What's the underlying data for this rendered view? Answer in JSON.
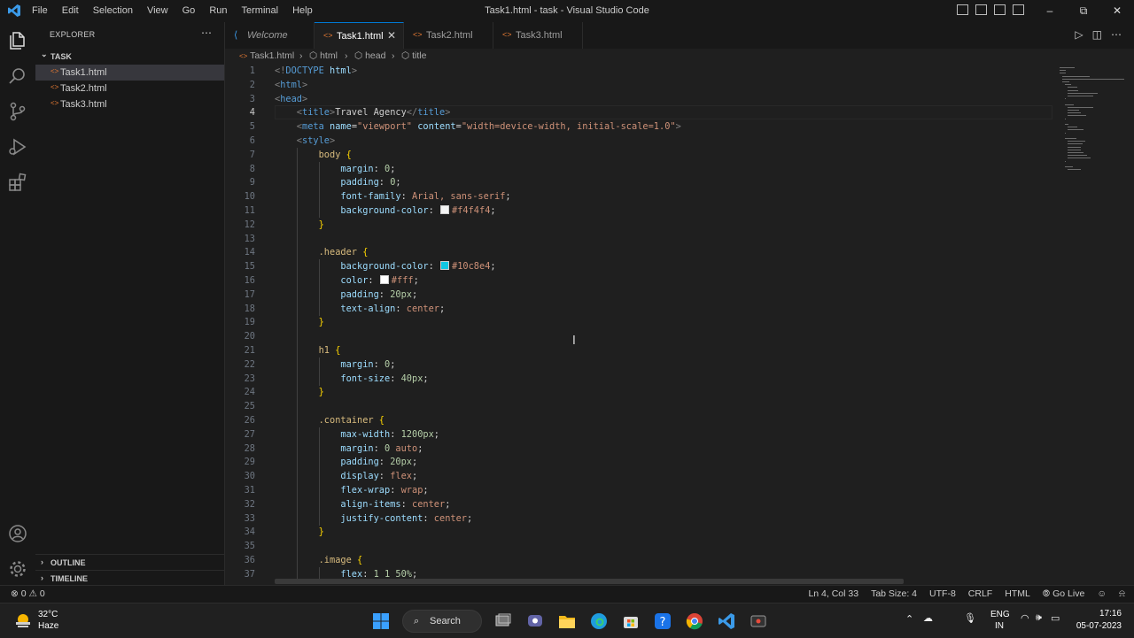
{
  "window": {
    "title": "Task1.html - task - Visual Studio Code",
    "menu": [
      "File",
      "Edit",
      "Selection",
      "View",
      "Go",
      "Run",
      "Terminal",
      "Help"
    ]
  },
  "sidebar": {
    "header": "EXPLORER",
    "folder": "TASK",
    "files": [
      "Task1.html",
      "Task2.html",
      "Task3.html"
    ],
    "outline": "OUTLINE",
    "timeline": "TIMELINE"
  },
  "tabs": [
    {
      "label": "Welcome"
    },
    {
      "label": "Task1.html"
    },
    {
      "label": "Task2.html"
    },
    {
      "label": "Task3.html"
    }
  ],
  "breadcrumb": [
    "Task1.html",
    "html",
    "head",
    "title"
  ],
  "editor": {
    "lines": [
      {
        "n": "1",
        "indent": 0,
        "parts": [
          [
            "<!",
            "punc"
          ],
          [
            "DOCTYPE",
            "tag"
          ],
          [
            " html",
            "attr"
          ],
          [
            ">",
            "punc"
          ]
        ]
      },
      {
        "n": "2",
        "indent": 0,
        "parts": [
          [
            "<",
            "punc"
          ],
          [
            "html",
            "tag"
          ],
          [
            ">",
            "punc"
          ]
        ]
      },
      {
        "n": "3",
        "indent": 0,
        "parts": [
          [
            "<",
            "punc"
          ],
          [
            "head",
            "tag"
          ],
          [
            ">",
            "punc"
          ]
        ]
      },
      {
        "n": "4",
        "indent": 1,
        "parts": [
          [
            "<",
            "punc"
          ],
          [
            "title",
            "tag"
          ],
          [
            ">",
            "punc"
          ],
          [
            "Travel Agency",
            "text"
          ],
          [
            "</",
            "punc"
          ],
          [
            "title",
            "tag"
          ],
          [
            ">",
            "punc"
          ]
        ]
      },
      {
        "n": "5",
        "indent": 1,
        "parts": [
          [
            "<",
            "punc"
          ],
          [
            "meta",
            "tag"
          ],
          [
            " name",
            "attr"
          ],
          [
            "=",
            "plain"
          ],
          [
            "\"viewport\"",
            "str"
          ],
          [
            " content",
            "attr"
          ],
          [
            "=",
            "plain"
          ],
          [
            "\"width=device-width, initial-scale=1.0\"",
            "str"
          ],
          [
            ">",
            "punc"
          ]
        ]
      },
      {
        "n": "6",
        "indent": 1,
        "parts": [
          [
            "<",
            "punc"
          ],
          [
            "style",
            "tag"
          ],
          [
            ">",
            "punc"
          ]
        ]
      },
      {
        "n": "7",
        "indent": 2,
        "parts": [
          [
            "body",
            "sel"
          ],
          [
            " {",
            "brace"
          ]
        ]
      },
      {
        "n": "8",
        "indent": 3,
        "parts": [
          [
            "margin",
            "prop"
          ],
          [
            ": ",
            "plain"
          ],
          [
            "0",
            "num"
          ],
          [
            ";",
            "plain"
          ]
        ]
      },
      {
        "n": "9",
        "indent": 3,
        "parts": [
          [
            "padding",
            "prop"
          ],
          [
            ": ",
            "plain"
          ],
          [
            "0",
            "num"
          ],
          [
            ";",
            "plain"
          ]
        ]
      },
      {
        "n": "10",
        "indent": 3,
        "parts": [
          [
            "font-family",
            "prop"
          ],
          [
            ": ",
            "plain"
          ],
          [
            "Arial, sans-serif",
            "val"
          ],
          [
            ";",
            "plain"
          ]
        ]
      },
      {
        "n": "11",
        "indent": 3,
        "parts": [
          [
            "background-color",
            "prop"
          ],
          [
            ": ",
            "plain"
          ],
          [
            "#f4f4f4",
            "swatch:#f4f4f4"
          ],
          [
            "#f4f4f4",
            "val"
          ],
          [
            ";",
            "plain"
          ]
        ]
      },
      {
        "n": "12",
        "indent": 2,
        "parts": [
          [
            "}",
            "brace"
          ]
        ]
      },
      {
        "n": "13",
        "indent": 2,
        "parts": []
      },
      {
        "n": "14",
        "indent": 2,
        "parts": [
          [
            ".header",
            "sel"
          ],
          [
            " {",
            "brace"
          ]
        ]
      },
      {
        "n": "15",
        "indent": 3,
        "parts": [
          [
            "background-color",
            "prop"
          ],
          [
            ": ",
            "plain"
          ],
          [
            "#10c8e4",
            "swatch:#10c8e4"
          ],
          [
            "#10c8e4",
            "val"
          ],
          [
            ";",
            "plain"
          ]
        ]
      },
      {
        "n": "16",
        "indent": 3,
        "parts": [
          [
            "color",
            "prop"
          ],
          [
            ": ",
            "plain"
          ],
          [
            "#fff",
            "swatch:#ffffff"
          ],
          [
            "#fff",
            "val"
          ],
          [
            ";",
            "plain"
          ]
        ]
      },
      {
        "n": "17",
        "indent": 3,
        "parts": [
          [
            "padding",
            "prop"
          ],
          [
            ": ",
            "plain"
          ],
          [
            "20px",
            "num"
          ],
          [
            ";",
            "plain"
          ]
        ]
      },
      {
        "n": "18",
        "indent": 3,
        "parts": [
          [
            "text-align",
            "prop"
          ],
          [
            ": ",
            "plain"
          ],
          [
            "center",
            "val"
          ],
          [
            ";",
            "plain"
          ]
        ]
      },
      {
        "n": "19",
        "indent": 2,
        "parts": [
          [
            "}",
            "brace"
          ]
        ]
      },
      {
        "n": "20",
        "indent": 2,
        "parts": []
      },
      {
        "n": "21",
        "indent": 2,
        "parts": [
          [
            "h1",
            "sel"
          ],
          [
            " {",
            "brace"
          ]
        ]
      },
      {
        "n": "22",
        "indent": 3,
        "parts": [
          [
            "margin",
            "prop"
          ],
          [
            ": ",
            "plain"
          ],
          [
            "0",
            "num"
          ],
          [
            ";",
            "plain"
          ]
        ]
      },
      {
        "n": "23",
        "indent": 3,
        "parts": [
          [
            "font-size",
            "prop"
          ],
          [
            ": ",
            "plain"
          ],
          [
            "40px",
            "num"
          ],
          [
            ";",
            "plain"
          ]
        ]
      },
      {
        "n": "24",
        "indent": 2,
        "parts": [
          [
            "}",
            "brace"
          ]
        ]
      },
      {
        "n": "25",
        "indent": 2,
        "parts": []
      },
      {
        "n": "26",
        "indent": 2,
        "parts": [
          [
            ".container",
            "sel"
          ],
          [
            " {",
            "brace"
          ]
        ]
      },
      {
        "n": "27",
        "indent": 3,
        "parts": [
          [
            "max-width",
            "prop"
          ],
          [
            ": ",
            "plain"
          ],
          [
            "1200px",
            "num"
          ],
          [
            ";",
            "plain"
          ]
        ]
      },
      {
        "n": "28",
        "indent": 3,
        "parts": [
          [
            "margin",
            "prop"
          ],
          [
            ": ",
            "plain"
          ],
          [
            "0",
            "num"
          ],
          [
            " auto",
            "val"
          ],
          [
            ";",
            "plain"
          ]
        ]
      },
      {
        "n": "29",
        "indent": 3,
        "parts": [
          [
            "padding",
            "prop"
          ],
          [
            ": ",
            "plain"
          ],
          [
            "20px",
            "num"
          ],
          [
            ";",
            "plain"
          ]
        ]
      },
      {
        "n": "30",
        "indent": 3,
        "parts": [
          [
            "display",
            "prop"
          ],
          [
            ": ",
            "plain"
          ],
          [
            "flex",
            "val"
          ],
          [
            ";",
            "plain"
          ]
        ]
      },
      {
        "n": "31",
        "indent": 3,
        "parts": [
          [
            "flex-wrap",
            "prop"
          ],
          [
            ": ",
            "plain"
          ],
          [
            "wrap",
            "val"
          ],
          [
            ";",
            "plain"
          ]
        ]
      },
      {
        "n": "32",
        "indent": 3,
        "parts": [
          [
            "align-items",
            "prop"
          ],
          [
            ": ",
            "plain"
          ],
          [
            "center",
            "val"
          ],
          [
            ";",
            "plain"
          ]
        ]
      },
      {
        "n": "33",
        "indent": 3,
        "parts": [
          [
            "justify-content",
            "prop"
          ],
          [
            ": ",
            "plain"
          ],
          [
            "center",
            "val"
          ],
          [
            ";",
            "plain"
          ]
        ]
      },
      {
        "n": "34",
        "indent": 2,
        "parts": [
          [
            "}",
            "brace"
          ]
        ]
      },
      {
        "n": "35",
        "indent": 2,
        "parts": []
      },
      {
        "n": "36",
        "indent": 2,
        "parts": [
          [
            ".image",
            "sel"
          ],
          [
            " {",
            "brace"
          ]
        ]
      },
      {
        "n": "37",
        "indent": 3,
        "parts": [
          [
            "flex",
            "prop"
          ],
          [
            ": ",
            "plain"
          ],
          [
            "1 1 50%",
            "num"
          ],
          [
            ";",
            "plain"
          ]
        ]
      }
    ],
    "current_line": "4"
  },
  "status": {
    "problems": "0",
    "warnings": "0",
    "position": "Ln 4, Col 33",
    "tab_size": "Tab Size: 4",
    "encoding": "UTF-8",
    "eol": "CRLF",
    "language": "HTML",
    "go_live": "Go Live"
  },
  "taskbar": {
    "temperature": "32°C",
    "condition": "Haze",
    "search_label": "Search",
    "lang_line1": "ENG",
    "lang_line2": "IN",
    "time": "17:16",
    "date": "05-07-2023"
  },
  "colors": {
    "accent": "#0078d4",
    "file_icon": "#e37933",
    "editor_bg": "#1f1f1f"
  }
}
